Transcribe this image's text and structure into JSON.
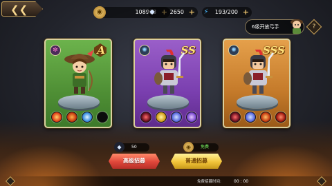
{
  "resources": {
    "gold": "108998",
    "gems": "2650",
    "energy": "193/200"
  },
  "quest": {
    "label": "6级开放弓手"
  },
  "help": "?",
  "cards": [
    {
      "grade": "A",
      "theme": "#5a9c3e"
    },
    {
      "grade": "SS",
      "theme": "#8a4fbf"
    },
    {
      "grade": "SSS",
      "theme": "#d48b35"
    }
  ],
  "summon": {
    "advanced": {
      "label": "高级招募",
      "cost": "50"
    },
    "normal": {
      "label": "普通招募",
      "cost": "免费"
    }
  },
  "footer": {
    "free_label": "免费招募时间:",
    "timer": "00 : 00"
  }
}
